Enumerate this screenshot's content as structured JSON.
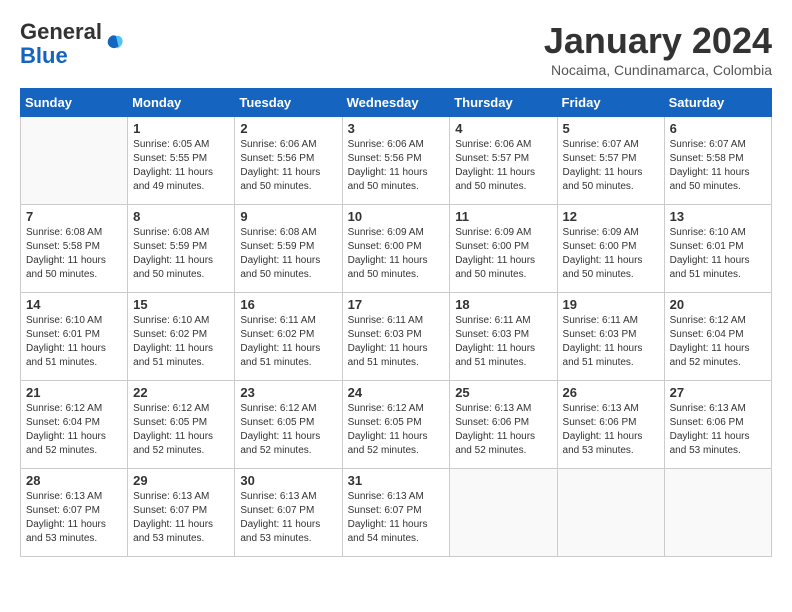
{
  "header": {
    "logo_general": "General",
    "logo_blue": "Blue",
    "month_title": "January 2024",
    "location": "Nocaima, Cundinamarca, Colombia"
  },
  "days_of_week": [
    "Sunday",
    "Monday",
    "Tuesday",
    "Wednesday",
    "Thursday",
    "Friday",
    "Saturday"
  ],
  "weeks": [
    [
      {
        "day": "",
        "info": ""
      },
      {
        "day": "1",
        "info": "Sunrise: 6:05 AM\nSunset: 5:55 PM\nDaylight: 11 hours\nand 49 minutes."
      },
      {
        "day": "2",
        "info": "Sunrise: 6:06 AM\nSunset: 5:56 PM\nDaylight: 11 hours\nand 50 minutes."
      },
      {
        "day": "3",
        "info": "Sunrise: 6:06 AM\nSunset: 5:56 PM\nDaylight: 11 hours\nand 50 minutes."
      },
      {
        "day": "4",
        "info": "Sunrise: 6:06 AM\nSunset: 5:57 PM\nDaylight: 11 hours\nand 50 minutes."
      },
      {
        "day": "5",
        "info": "Sunrise: 6:07 AM\nSunset: 5:57 PM\nDaylight: 11 hours\nand 50 minutes."
      },
      {
        "day": "6",
        "info": "Sunrise: 6:07 AM\nSunset: 5:58 PM\nDaylight: 11 hours\nand 50 minutes."
      }
    ],
    [
      {
        "day": "7",
        "info": "Sunrise: 6:08 AM\nSunset: 5:58 PM\nDaylight: 11 hours\nand 50 minutes."
      },
      {
        "day": "8",
        "info": "Sunrise: 6:08 AM\nSunset: 5:59 PM\nDaylight: 11 hours\nand 50 minutes."
      },
      {
        "day": "9",
        "info": "Sunrise: 6:08 AM\nSunset: 5:59 PM\nDaylight: 11 hours\nand 50 minutes."
      },
      {
        "day": "10",
        "info": "Sunrise: 6:09 AM\nSunset: 6:00 PM\nDaylight: 11 hours\nand 50 minutes."
      },
      {
        "day": "11",
        "info": "Sunrise: 6:09 AM\nSunset: 6:00 PM\nDaylight: 11 hours\nand 50 minutes."
      },
      {
        "day": "12",
        "info": "Sunrise: 6:09 AM\nSunset: 6:00 PM\nDaylight: 11 hours\nand 50 minutes."
      },
      {
        "day": "13",
        "info": "Sunrise: 6:10 AM\nSunset: 6:01 PM\nDaylight: 11 hours\nand 51 minutes."
      }
    ],
    [
      {
        "day": "14",
        "info": "Sunrise: 6:10 AM\nSunset: 6:01 PM\nDaylight: 11 hours\nand 51 minutes."
      },
      {
        "day": "15",
        "info": "Sunrise: 6:10 AM\nSunset: 6:02 PM\nDaylight: 11 hours\nand 51 minutes."
      },
      {
        "day": "16",
        "info": "Sunrise: 6:11 AM\nSunset: 6:02 PM\nDaylight: 11 hours\nand 51 minutes."
      },
      {
        "day": "17",
        "info": "Sunrise: 6:11 AM\nSunset: 6:03 PM\nDaylight: 11 hours\nand 51 minutes."
      },
      {
        "day": "18",
        "info": "Sunrise: 6:11 AM\nSunset: 6:03 PM\nDaylight: 11 hours\nand 51 minutes."
      },
      {
        "day": "19",
        "info": "Sunrise: 6:11 AM\nSunset: 6:03 PM\nDaylight: 11 hours\nand 51 minutes."
      },
      {
        "day": "20",
        "info": "Sunrise: 6:12 AM\nSunset: 6:04 PM\nDaylight: 11 hours\nand 52 minutes."
      }
    ],
    [
      {
        "day": "21",
        "info": "Sunrise: 6:12 AM\nSunset: 6:04 PM\nDaylight: 11 hours\nand 52 minutes."
      },
      {
        "day": "22",
        "info": "Sunrise: 6:12 AM\nSunset: 6:05 PM\nDaylight: 11 hours\nand 52 minutes."
      },
      {
        "day": "23",
        "info": "Sunrise: 6:12 AM\nSunset: 6:05 PM\nDaylight: 11 hours\nand 52 minutes."
      },
      {
        "day": "24",
        "info": "Sunrise: 6:12 AM\nSunset: 6:05 PM\nDaylight: 11 hours\nand 52 minutes."
      },
      {
        "day": "25",
        "info": "Sunrise: 6:13 AM\nSunset: 6:06 PM\nDaylight: 11 hours\nand 52 minutes."
      },
      {
        "day": "26",
        "info": "Sunrise: 6:13 AM\nSunset: 6:06 PM\nDaylight: 11 hours\nand 53 minutes."
      },
      {
        "day": "27",
        "info": "Sunrise: 6:13 AM\nSunset: 6:06 PM\nDaylight: 11 hours\nand 53 minutes."
      }
    ],
    [
      {
        "day": "28",
        "info": "Sunrise: 6:13 AM\nSunset: 6:07 PM\nDaylight: 11 hours\nand 53 minutes."
      },
      {
        "day": "29",
        "info": "Sunrise: 6:13 AM\nSunset: 6:07 PM\nDaylight: 11 hours\nand 53 minutes."
      },
      {
        "day": "30",
        "info": "Sunrise: 6:13 AM\nSunset: 6:07 PM\nDaylight: 11 hours\nand 53 minutes."
      },
      {
        "day": "31",
        "info": "Sunrise: 6:13 AM\nSunset: 6:07 PM\nDaylight: 11 hours\nand 54 minutes."
      },
      {
        "day": "",
        "info": ""
      },
      {
        "day": "",
        "info": ""
      },
      {
        "day": "",
        "info": ""
      }
    ]
  ]
}
